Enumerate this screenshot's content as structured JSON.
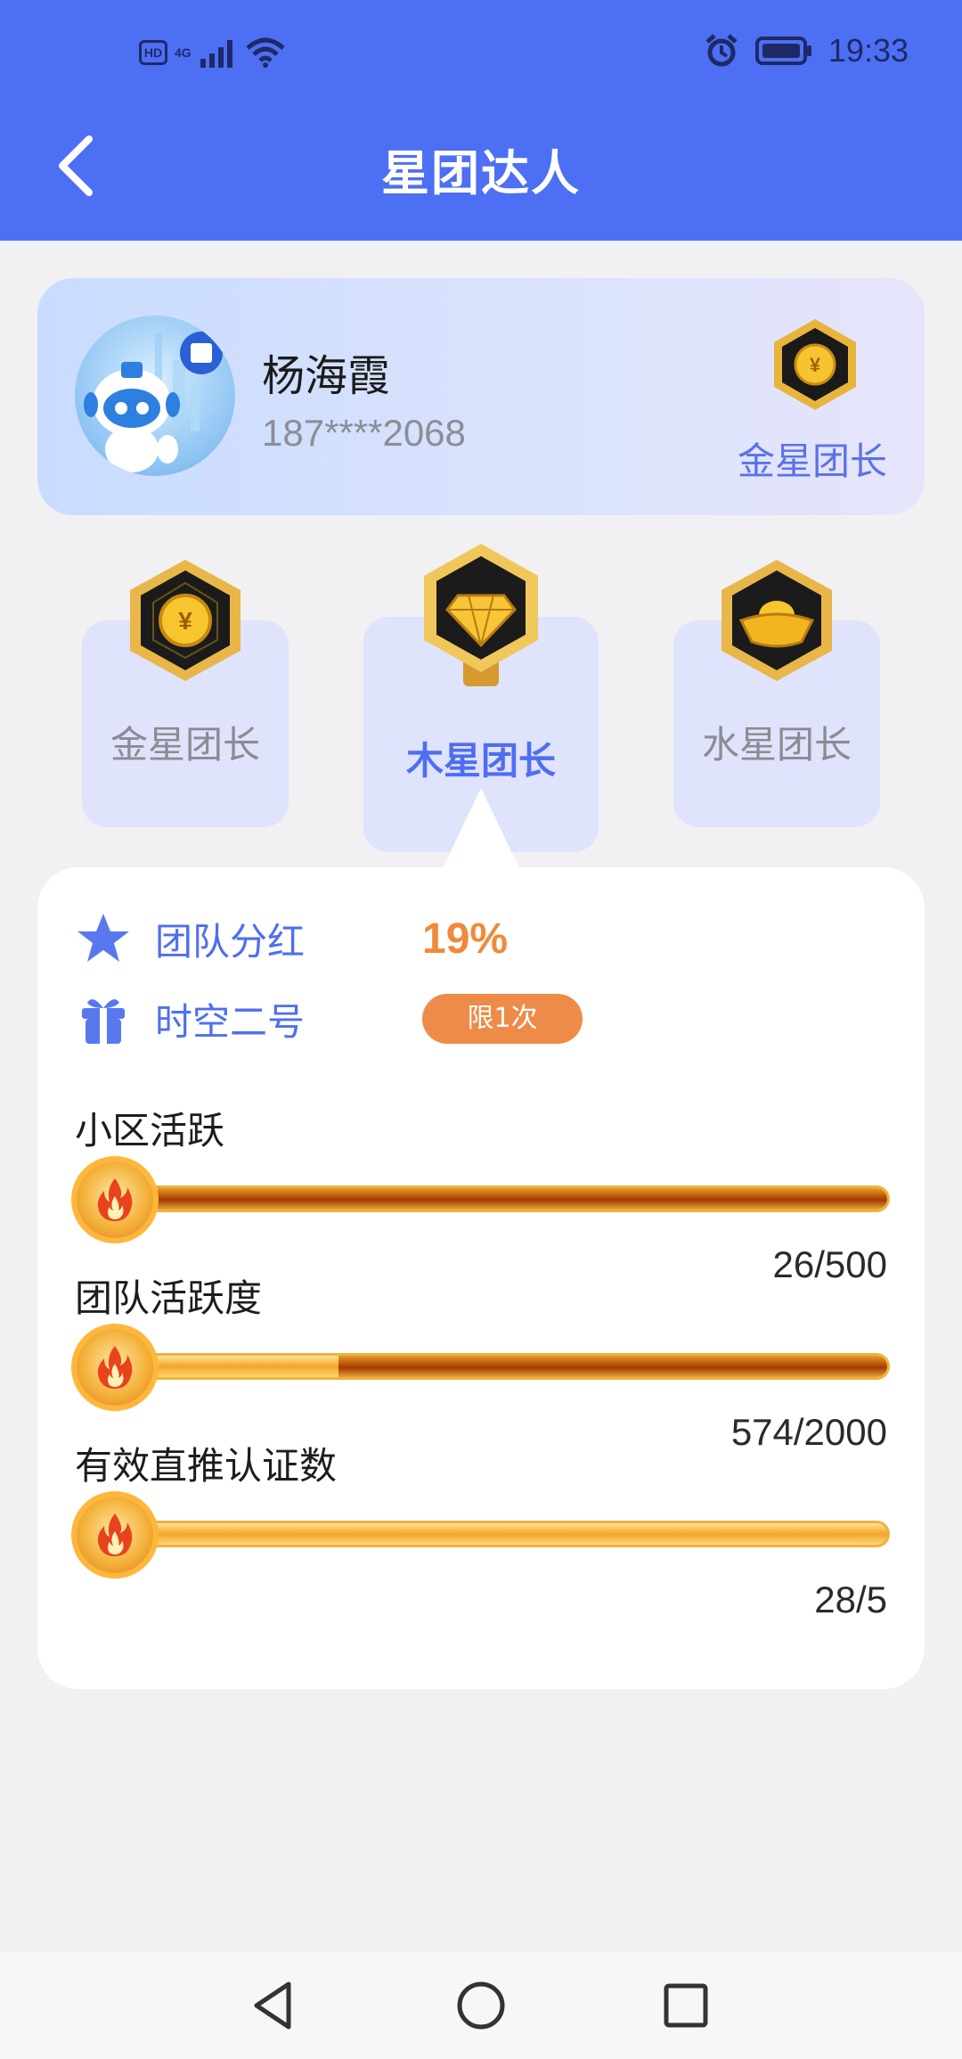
{
  "status_bar": {
    "time": "19:33",
    "hd": "HD",
    "network": "4G",
    "icons": [
      "signal-icon",
      "wifi-icon",
      "alarm-icon",
      "battery-icon"
    ]
  },
  "header": {
    "title": "星团达人",
    "back_icon": "back-arrow-icon",
    "background": "#4d6ff3"
  },
  "profile": {
    "name": "杨海霞",
    "phone": "187****2068",
    "current_level": "金星团长",
    "level_icon": "gold-coin-medal-icon"
  },
  "levels": [
    {
      "label": "金星团长",
      "icon": "gold-coin-medal-icon",
      "active": false
    },
    {
      "label": "木星团长",
      "icon": "diamond-medal-icon",
      "active": true
    },
    {
      "label": "水星团长",
      "icon": "gold-ingot-medal-icon",
      "active": false
    }
  ],
  "benefits": [
    {
      "label": "团队分红",
      "icon": "star-icon",
      "value": "19%"
    },
    {
      "label": "时空二号",
      "icon": "gift-icon",
      "badge": "限1次"
    }
  ],
  "progress": [
    {
      "title": "小区活跃",
      "current": 26,
      "target": 500,
      "count_text": "26/500",
      "fraction": 0.052
    },
    {
      "title": "团队活跃度",
      "current": 574,
      "target": 2000,
      "count_text": "574/2000",
      "fraction": 0.287
    },
    {
      "title": "有效直推认证数",
      "current": 28,
      "target": 5,
      "count_text": "28/5",
      "fraction": 1.0
    }
  ],
  "colors": {
    "accent": "#4f6ef0",
    "highlight_orange": "#f08a3a",
    "badge_orange": "#ef8b48"
  },
  "navbar": {
    "icons": [
      "nav-back-icon",
      "nav-home-icon",
      "nav-recents-icon"
    ]
  }
}
